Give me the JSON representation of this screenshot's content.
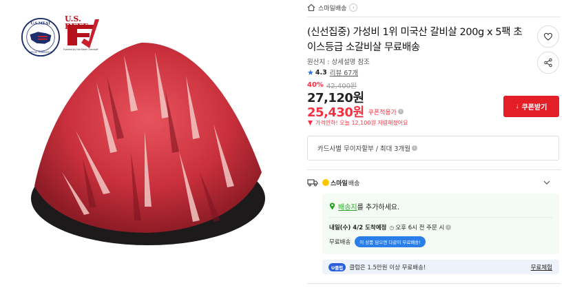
{
  "logos": {
    "usmeat_text": "U.S.MEAT",
    "usmeat_sub": "EXPORT FEDERATION",
    "usbeef_text": "U.S. BEEF",
    "usbeef_sub": "Funded by the Beef Checkoff"
  },
  "store": {
    "name": "스마일배송",
    "arrow": "›"
  },
  "product": {
    "title": "(신선집중) 가성비 1위 미국산 갈비살 200g x 5팩 초이스등급 소갈비살 무료배송",
    "origin": "원산지 : 상세설명 참조",
    "rating": "4.3",
    "review_link": "리뷰 67개",
    "discount_rate": "40%",
    "original_price": "42,400원",
    "sale_price": "27,120원",
    "coupon_price": "25,430원",
    "coupon_applied": "쿠폰적용가",
    "lowest_price_text": "가격인하! 오늘 12,100원 저렴해졌어요"
  },
  "buttons": {
    "coupon": "쿠폰받기",
    "coupon_icon": "↓"
  },
  "card_installment": "카드사별 무이자할부 / 최대 3개월",
  "shipping": {
    "badge": "스마일",
    "badge_sub": "배송",
    "address_link": "배송지",
    "address_text": "를 추가하세요.",
    "eta_bold": "내일(수) 4/2 도착예정",
    "eta_time": "오후 6시 전 주문 시",
    "free_label": "무료배송",
    "free_bubble": "이 상품 담으면 다같이 무료배송!",
    "club_badge": "U클럽",
    "club_text": "클럽은 1.5만원 이상 무료배송!",
    "club_link": "무료체험"
  },
  "icons": {
    "home": "home-icon",
    "heart": "heart-icon",
    "share": "share-icon",
    "star": "star-icon",
    "truck": "truck-icon",
    "pin": "location-pin-icon",
    "clock": "clock-icon",
    "chevron": "chevron-down-icon"
  },
  "colors": {
    "accent_red": "#e41e26",
    "price_red": "#f43142",
    "star_blue": "#2a6fdb",
    "green": "#2aa52a",
    "club_blue": "#2b5fd9"
  }
}
